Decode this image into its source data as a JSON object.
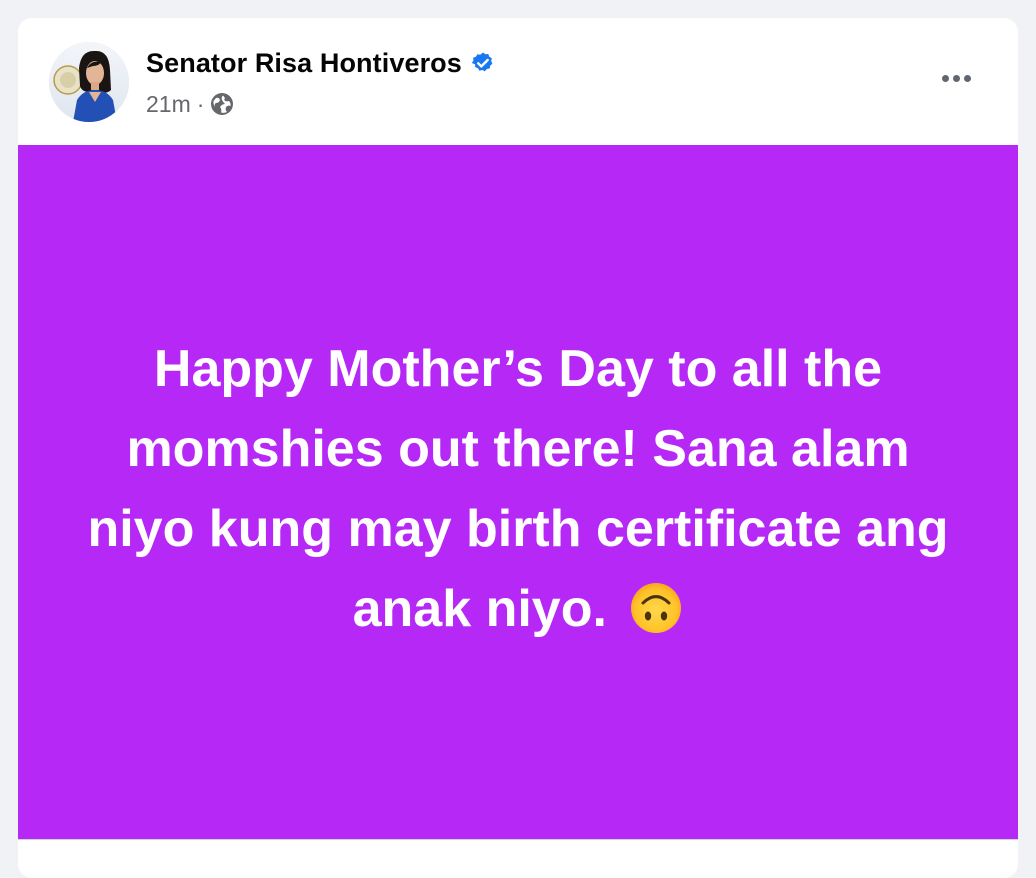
{
  "post": {
    "author": "Senator Risa Hontiveros",
    "time": "21m",
    "separator": "·",
    "visibility_icon": "globe-icon",
    "verified_icon": "verified-badge-icon",
    "more_icon": "more-options-icon",
    "message": "Happy Mother’s Day to all the momshies out there! Sana alam niyo kung may birth certificate ang anak niyo.",
    "message_emoji": "upside-down-face",
    "background_color": "#b628f5"
  },
  "colors": {
    "page_bg": "#f0f2f5",
    "card_bg": "#ffffff",
    "verified_blue": "#1877f2",
    "meta_gray": "#65676b",
    "text_white": "#ffffff"
  }
}
